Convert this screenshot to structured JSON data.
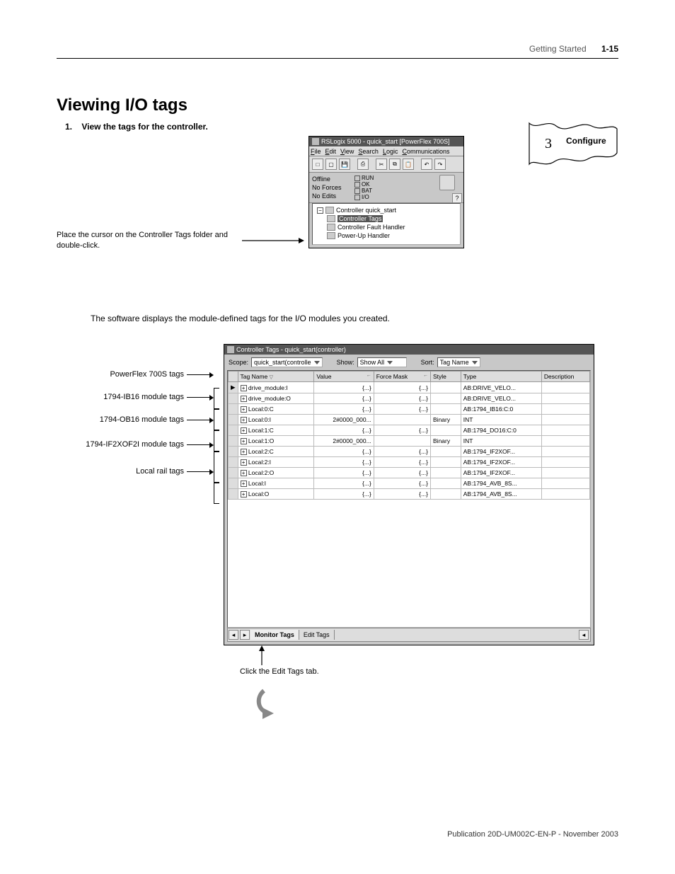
{
  "header": {
    "section": "Getting Started",
    "page_number": "1-15"
  },
  "title": "Viewing I/O tags",
  "step": {
    "number": "1.",
    "text": "View the tags for the controller."
  },
  "config_badge": {
    "number": "3",
    "label": "Configure"
  },
  "rslogix": {
    "title": "RSLogix 5000 - quick_start [PowerFlex 700S]",
    "menu": [
      "File",
      "Edit",
      "View",
      "Search",
      "Logic",
      "Communications"
    ],
    "status": {
      "offline": "Offline",
      "no_forces": "No Forces",
      "no_edits": "No Edits",
      "run": "RUN",
      "ok": "OK",
      "bat": "BAT",
      "io": "I/O"
    },
    "tree": {
      "root": "Controller quick_start",
      "item_selected": "Controller Tags",
      "item2": "Controller Fault Handler",
      "item3": "Power-Up Handler"
    }
  },
  "cursor_note": "Place the cursor on the Controller Tags folder and double-click.",
  "mid_text": "The software displays the module-defined tags for the I/O modules you created.",
  "ctags_win": {
    "title": "Controller Tags - quick_start(controller)",
    "scope_label": "Scope:",
    "scope_value": "quick_start(controlle",
    "show_label": "Show:",
    "show_value": "Show All",
    "sort_label": "Sort:",
    "sort_value": "Tag Name",
    "col_tag": "Tag Name",
    "col_value": "Value",
    "col_force": "Force Mask",
    "col_style": "Style",
    "col_type": "Type",
    "col_desc": "Description",
    "rows": [
      {
        "mark": "▶",
        "name": "drive_module:I",
        "value": "{...}",
        "force": "{...}",
        "style": "",
        "type": "AB:DRIVE_VELO..."
      },
      {
        "mark": "",
        "name": "drive_module:O",
        "value": "{...}",
        "force": "{...}",
        "style": "",
        "type": "AB:DRIVE_VELO..."
      },
      {
        "mark": "",
        "name": "Local:0:C",
        "value": "{...}",
        "force": "{...}",
        "style": "",
        "type": "AB:1794_IB16:C:0"
      },
      {
        "mark": "",
        "name": "Local:0:I",
        "value": "2#0000_000...",
        "force": "",
        "style": "Binary",
        "type": "INT"
      },
      {
        "mark": "",
        "name": "Local:1:C",
        "value": "{...}",
        "force": "{...}",
        "style": "",
        "type": "AB:1794_DO16:C:0"
      },
      {
        "mark": "",
        "name": "Local:1:O",
        "value": "2#0000_000...",
        "force": "",
        "style": "Binary",
        "type": "INT"
      },
      {
        "mark": "",
        "name": "Local:2:C",
        "value": "{...}",
        "force": "{...}",
        "style": "",
        "type": "AB:1794_IF2XOF..."
      },
      {
        "mark": "",
        "name": "Local:2:I",
        "value": "{...}",
        "force": "{...}",
        "style": "",
        "type": "AB:1794_IF2XOF..."
      },
      {
        "mark": "",
        "name": "Local:2:O",
        "value": "{...}",
        "force": "{...}",
        "style": "",
        "type": "AB:1794_IF2XOF..."
      },
      {
        "mark": "",
        "name": "Local:I",
        "value": "{...}",
        "force": "{...}",
        "style": "",
        "type": "AB:1794_AVB_8S..."
      },
      {
        "mark": "",
        "name": "Local:O",
        "value": "{...}",
        "force": "{...}",
        "style": "",
        "type": "AB:1794_AVB_8S..."
      }
    ],
    "tab_monitor": "Monitor Tags",
    "tab_edit": "Edit Tags"
  },
  "sidelabels": {
    "l0": "PowerFlex 700S  tags",
    "l1": "1794-IB16 module tags",
    "l2": "1794-OB16 module tags",
    "l3": "1794-IF2XOF2I module tags",
    "l4": "Local rail tags"
  },
  "edit_note": "Click the Edit Tags tab.",
  "footer": "Publication 20D-UM002C-EN-P - November 2003"
}
